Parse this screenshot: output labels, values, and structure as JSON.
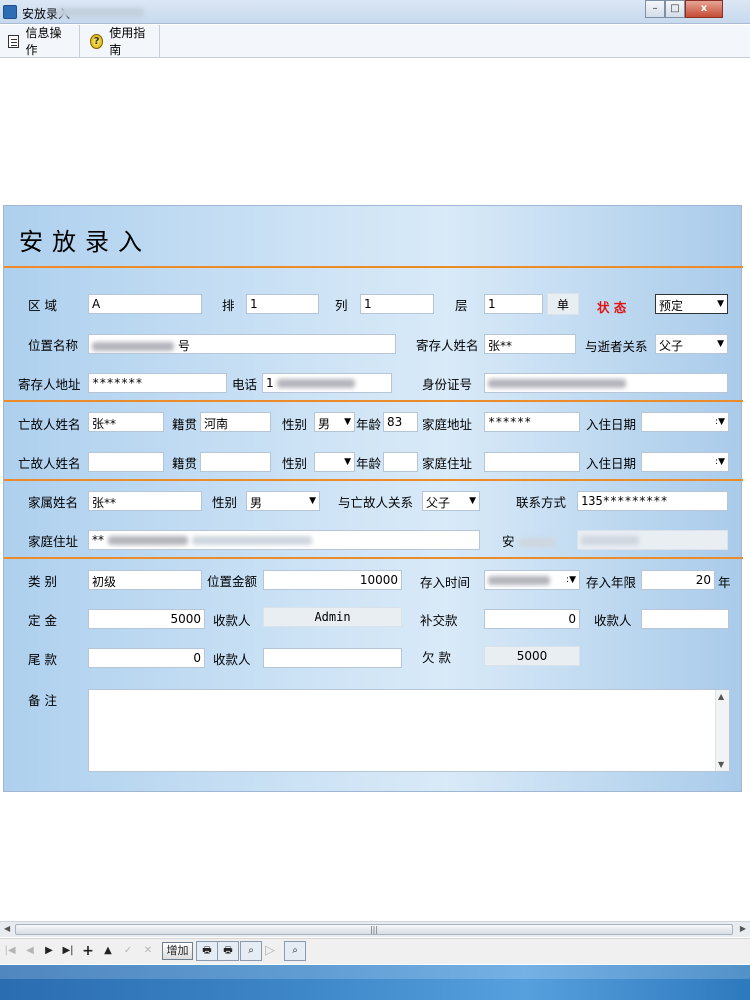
{
  "window": {
    "title": "安放录入",
    "controls": {
      "minimize": "–",
      "maximize": "□",
      "close": "x"
    }
  },
  "menu": [
    {
      "label": "信息操作",
      "icon": "document-icon"
    },
    {
      "label": "使用指南",
      "icon": "help-icon"
    }
  ],
  "form": {
    "heading": "安放录入",
    "location": {
      "area_label": "区  域",
      "area_value": "A",
      "row_label": "排",
      "row_value": "1",
      "col_label": "列",
      "col_value": "1",
      "layer_label": "层",
      "layer_value": "1",
      "unit_label": "单",
      "status_label": "状  态",
      "status_value": "预定",
      "position_label": "位置名称",
      "position_value": "号",
      "depositor_name_label": "寄存人姓名",
      "depositor_name_value": "张**",
      "relation_label": "与逝者关系",
      "relation_value": "父子",
      "depositor_addr_label": "寄存人地址",
      "depositor_addr_value": "*******",
      "phone_label": "电话",
      "phone_value": "1",
      "id_label": "身份证号",
      "id_value": ""
    },
    "deceased1": {
      "name_label": "亡故人姓名",
      "name_value": "张**",
      "origin_label": "籍贯",
      "origin_value": "河南",
      "gender_label": "性别",
      "gender_value": "男",
      "age_label": "年龄",
      "age_value": "83",
      "home_label": "家庭地址",
      "home_value": "******",
      "date_label": "入住日期",
      "date_value": ""
    },
    "deceased2": {
      "name_label": "亡故人姓名",
      "name_value": "",
      "origin_label": "籍贯",
      "origin_value": "",
      "gender_label": "性别",
      "gender_value": "",
      "age_label": "年龄",
      "age_value": "",
      "home_label": "家庭住址",
      "home_value": "",
      "date_label": "入住日期",
      "date_value": ""
    },
    "family": {
      "name_label": "家属姓名",
      "name_value": "张**",
      "gender_label": "性别",
      "gender_value": "男",
      "relation_label": "与亡故人关系",
      "relation_value": "父子",
      "contact_label": "联系方式",
      "contact_value": "135*********",
      "home_label": "家庭住址",
      "home_value": "**",
      "an_label": "安"
    },
    "fees": {
      "category_label": "类  别",
      "category_value": "初级",
      "amount_label": "位置金额",
      "amount_value": "10000",
      "deposit_time_label": "存入时间",
      "deposit_time_value": "",
      "deposit_years_label": "存入年限",
      "deposit_years_value": "20",
      "deposit_years_unit": "年",
      "deposit_label": "定  金",
      "deposit_value": "5000",
      "payee1_label": "收款人",
      "payee1_value": "Admin",
      "supplement_label": "补交款",
      "supplement_value": "0",
      "payee2_label": "收款人",
      "payee2_value": "",
      "final_label": "尾  款",
      "final_value": "0",
      "payee3_label": "收款人",
      "payee3_value": "",
      "owed_label": "欠  款",
      "owed_value": "5000",
      "remark_label": "备  注",
      "remark_value": ""
    }
  },
  "navigator": {
    "add_label": "增加",
    "icons": [
      "first-icon",
      "prior-icon",
      "next-icon",
      "last-icon",
      "insert-icon",
      "delete-icon",
      "post-icon",
      "cancel-icon",
      "print-icon",
      "print-preview-icon",
      "search-icon",
      "filter-icon",
      "find-icon"
    ]
  },
  "colors": {
    "separator": "#ec8b2a",
    "panel": "#cce2f5",
    "status_label": "#e01414"
  }
}
